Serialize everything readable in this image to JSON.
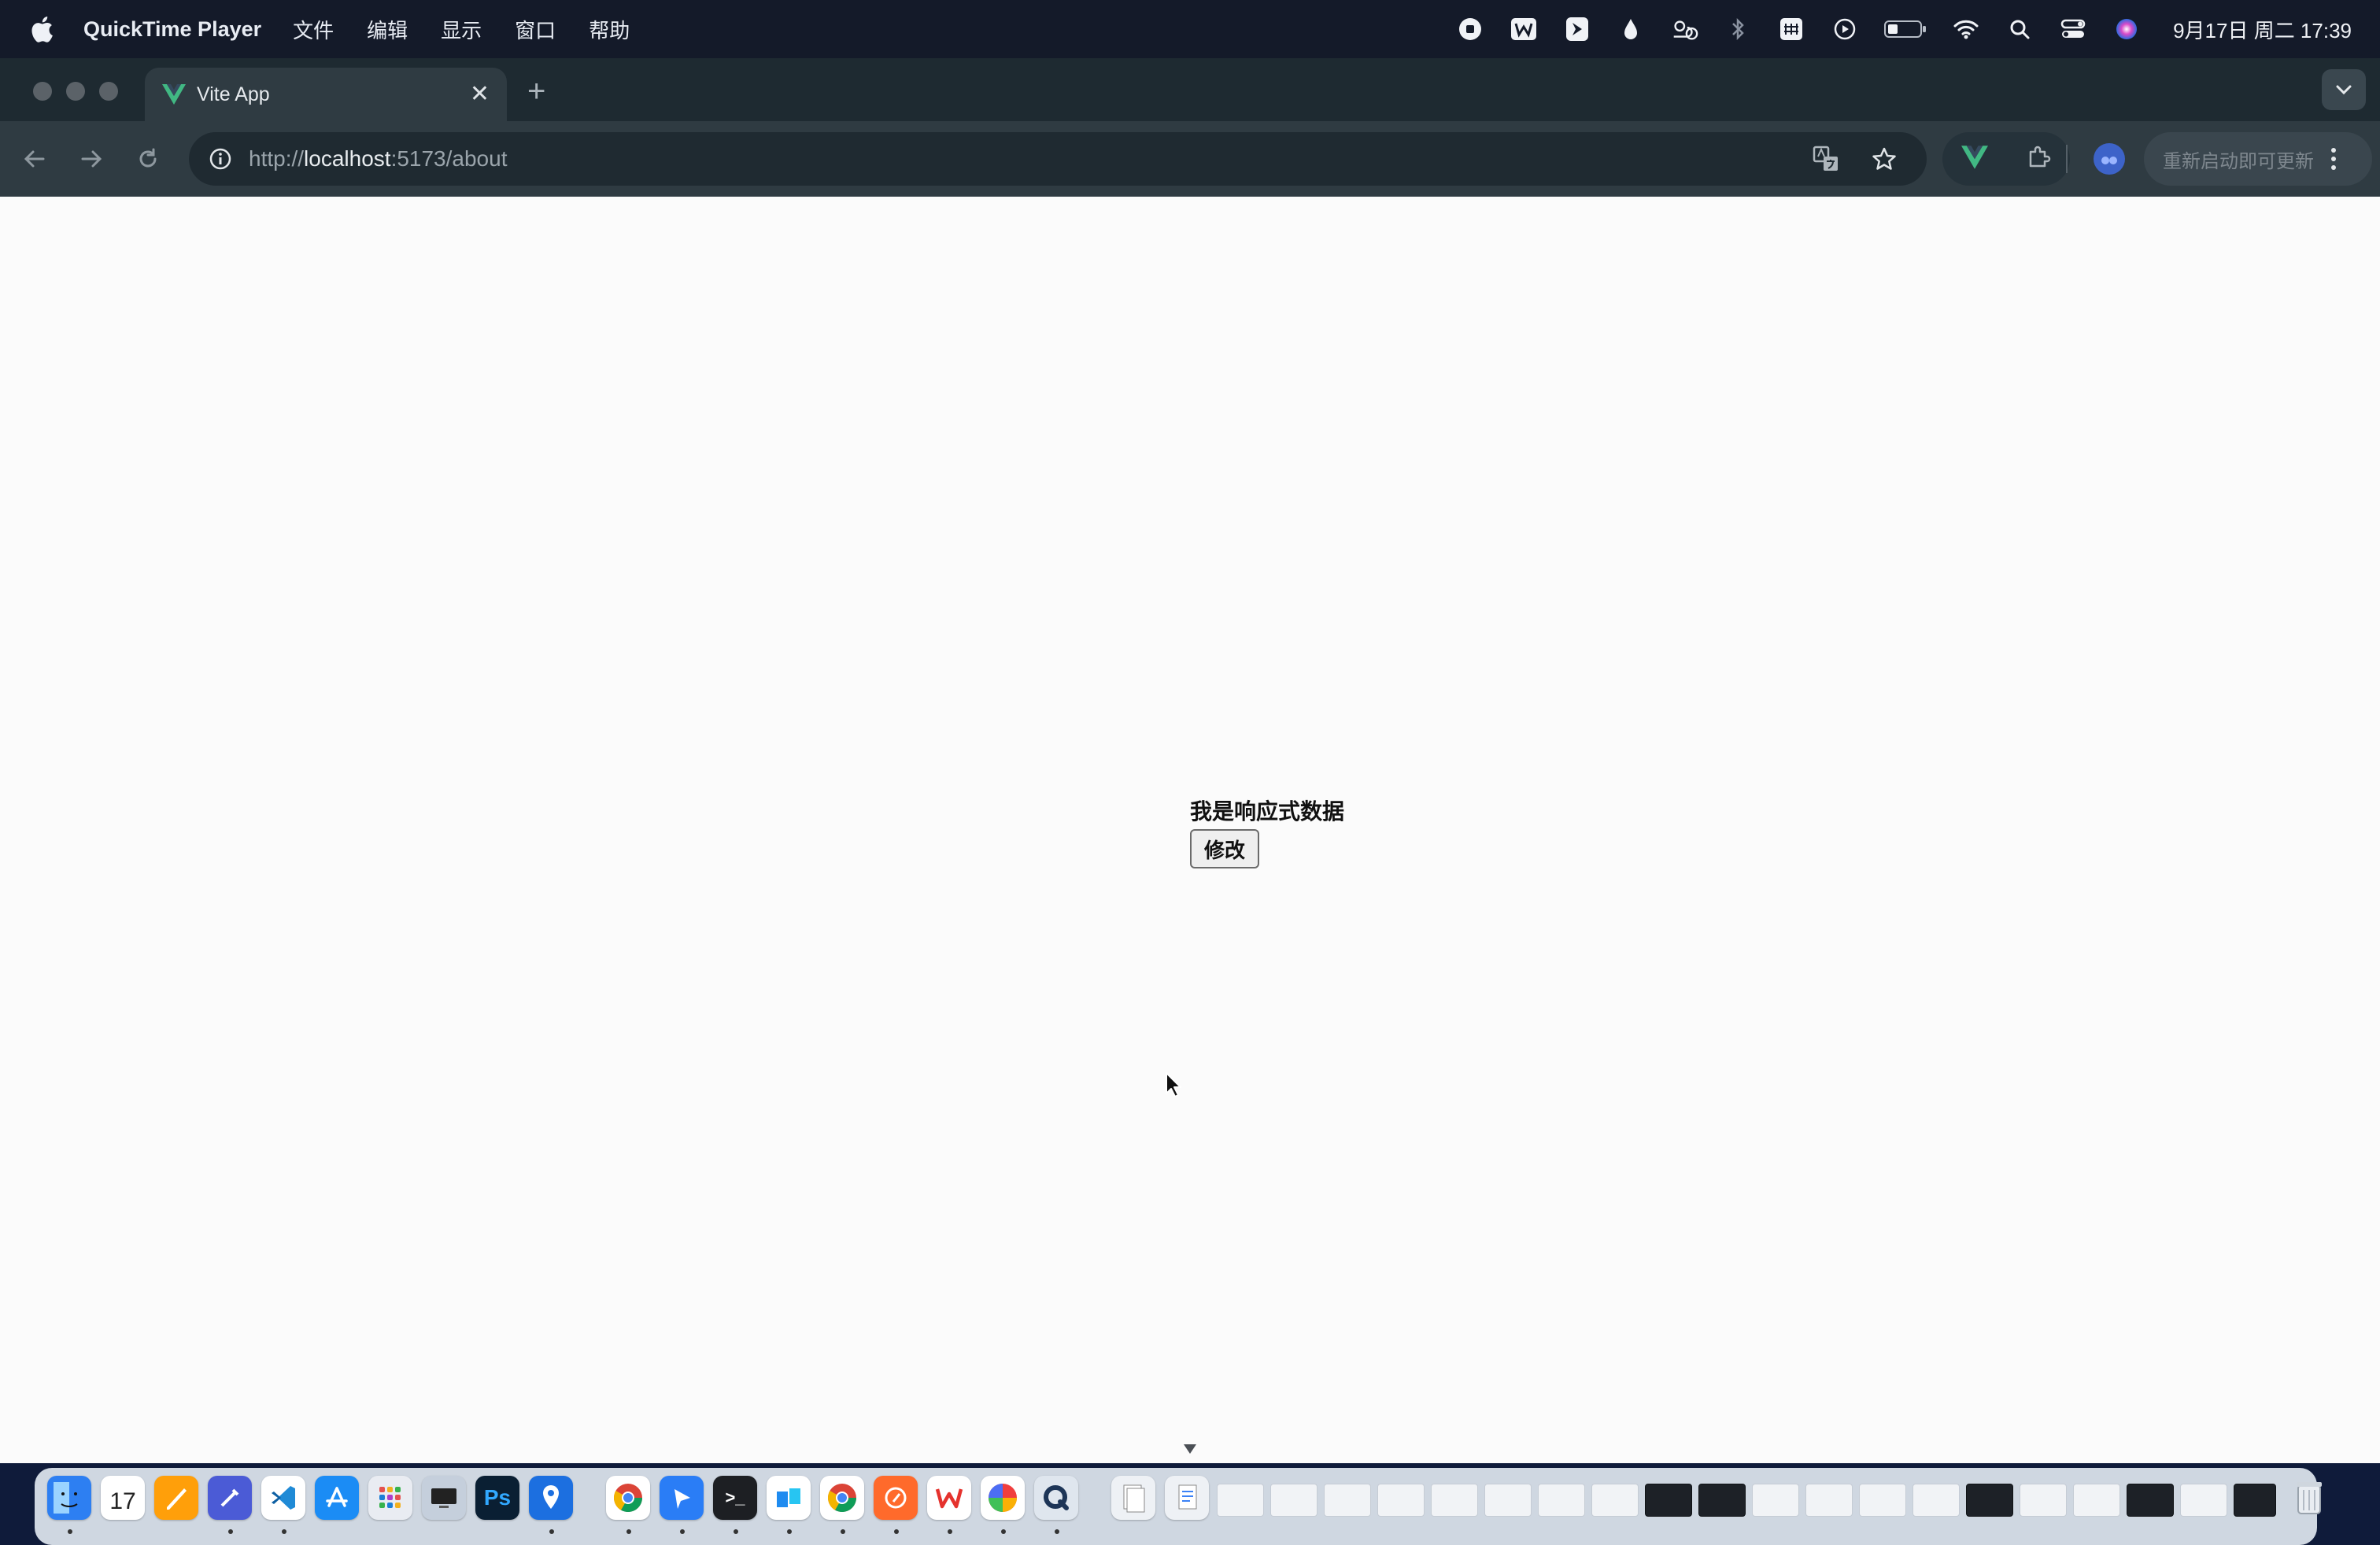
{
  "menubar": {
    "app_name": "QuickTime Player",
    "menus": [
      "文件",
      "编辑",
      "显示",
      "窗口",
      "帮助"
    ],
    "status_icons": [
      "record-stop-icon",
      "wps-icon",
      "feishu-icon",
      "drop-icon",
      "weather-icon",
      "bluetooth-icon",
      "input-method-icon",
      "play-icon",
      "battery-icon",
      "wifi-icon",
      "spotlight-search-icon",
      "control-center-icon",
      "siri-icon"
    ],
    "clock": "9月17日 周二 17:39"
  },
  "browser": {
    "tab_title": "Vite App",
    "url_host": "localhost",
    "url_prefix": "http://",
    "url_suffix": ":5173/about",
    "update_label": "重新启动即可更新"
  },
  "page": {
    "message": "我是响应式数据",
    "button_label": "修改"
  },
  "dock": {
    "calendar_date": "17"
  }
}
